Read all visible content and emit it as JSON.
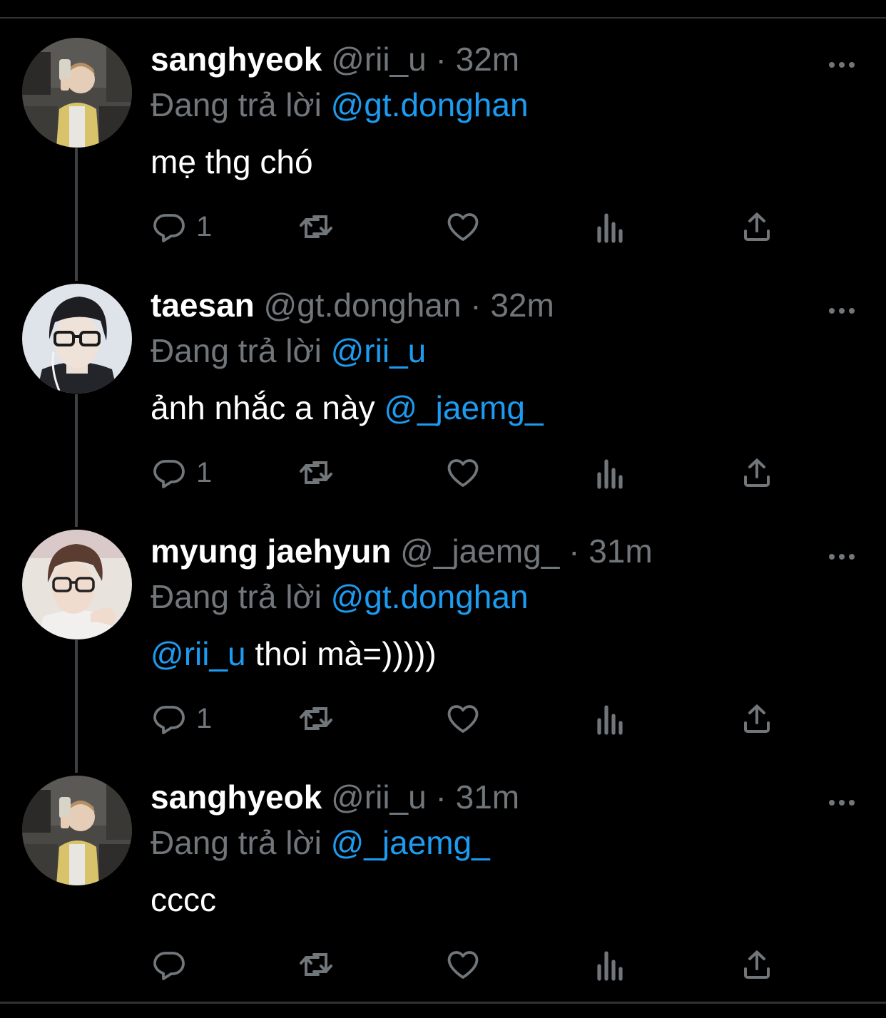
{
  "colors": {
    "background": "#000000",
    "text": "#ffffff",
    "muted": "#71767b",
    "mention": "#1d9bf0"
  },
  "tweets": [
    {
      "display_name": "sanghyeok",
      "handle": "@rii_u",
      "separator": "·",
      "time": "32m",
      "reply_prefix": "Đang trả lời",
      "reply_to": "@gt.donghan",
      "body_mention": "",
      "body_text": "mẹ thg chó",
      "body_mention_end": "",
      "reply_count": "1",
      "avatar": "avatar-photo-mirror-selfie",
      "icons": [
        "reply-icon",
        "retweet-icon",
        "like-icon",
        "views-icon",
        "share-icon",
        "more-icon"
      ]
    },
    {
      "display_name": "taesan",
      "handle": "@gt.donghan",
      "separator": "·",
      "time": "32m",
      "reply_prefix": "Đang trả lời",
      "reply_to": "@rii_u",
      "body_mention": "",
      "body_text": "ảnh nhắc a này ",
      "body_mention_end": "@_jaemg_",
      "reply_count": "1",
      "avatar": "avatar-photo-glasses",
      "icons": [
        "reply-icon",
        "retweet-icon",
        "like-icon",
        "views-icon",
        "share-icon",
        "more-icon"
      ]
    },
    {
      "display_name": "myung jaehyun",
      "handle": "@_jaemg_",
      "separator": "·",
      "time": "31m",
      "reply_prefix": "Đang trả lời",
      "reply_to": "@gt.donghan",
      "body_mention": "@rii_u",
      "body_text": " thoi mà=)))))",
      "body_mention_end": "",
      "reply_count": "1",
      "avatar": "avatar-photo-glasses-pink",
      "icons": [
        "reply-icon",
        "retweet-icon",
        "like-icon",
        "views-icon",
        "share-icon",
        "more-icon"
      ]
    },
    {
      "display_name": "sanghyeok",
      "handle": "@rii_u",
      "separator": "·",
      "time": "31m",
      "reply_prefix": "Đang trả lời",
      "reply_to": "@_jaemg_",
      "body_mention": "",
      "body_text": "cccc",
      "body_mention_end": "",
      "reply_count": "",
      "avatar": "avatar-photo-mirror-selfie",
      "icons": [
        "reply-icon",
        "retweet-icon",
        "like-icon",
        "views-icon",
        "share-icon",
        "more-icon"
      ]
    }
  ]
}
